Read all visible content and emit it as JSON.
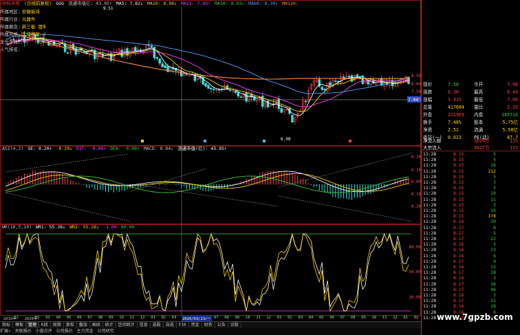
{
  "colors": {
    "up": "#ff4040",
    "down": "#40e0e0",
    "ma5": "#ffffff",
    "ma10": "#ffd400",
    "ma20": "#ff40ff",
    "ma60": "#30d040",
    "ma120": "#5aa0ff",
    "ma250": "#ff9040",
    "bg": "#000000"
  },
  "main_header": [
    "中科天塔",
    "(日线前复权)",
    "GGG",
    "流通市值亿: 43.95↑",
    "MA5: 7.82↓",
    "MA10: 8.08↓",
    "MA21: 7.95↑",
    "MA30: 8.03↓",
    "MA60: 8.30↓",
    "MA120: 8.88↓",
    "MA144: 9.14↓",
    "MA250: 8.82↑",
    "市场牛熊: 6.3"
  ],
  "sidebar": [
    {
      "k": "所属地区:",
      "v": "安徽板块"
    },
    {
      "k": "所属行业:",
      "v": "元器件"
    },
    {
      "k": "所属概念:",
      "v": "新三板 锂电池 燃料电池 新能源车 充电桩"
    },
    {
      "k": "所属风格:",
      "v": "定增预案 小盘"
    },
    {
      "k": "龙头个股:",
      "v": ""
    },
    {
      "k": "人气排名:",
      "v": ""
    }
  ],
  "main_ylabels": [
    "8.50",
    "8.00",
    "7.50",
    "7.00"
  ],
  "price_tag": "7.50",
  "price_level_tag": "7.06",
  "low_label": "6.98",
  "high_label": "9.51",
  "macd_header": [
    "ASI(4,2)",
    "SE: 0.20↑",
    "-0.20↓",
    "DIF: -0.06↑",
    "DEA: -0.08↑",
    "MACD: 0.04↓",
    "流通市值(亿): 43.95↑"
  ],
  "macd_ylabels": [
    "0.20",
    "0.10",
    "0.00",
    "-0.10",
    "-0.20"
  ],
  "wr_header": [
    "WR(10,5,10)",
    "WR1: 55.26↓",
    "WR2: 55.26↓",
    "-1.00",
    "80.00"
  ],
  "wr_ylabels": [
    "80.00",
    "50.00",
    "20.00"
  ],
  "x_labels": [
    "2019年",
    "12",
    "2020年",
    "02",
    "03",
    "04",
    "05",
    "06",
    "07",
    "08",
    "09",
    "10",
    "11",
    "12",
    "01",
    "02",
    "03",
    "04",
    "05",
    "06",
    "07",
    "08",
    "09",
    "10",
    "11",
    "12",
    "01",
    "02",
    "03",
    "04",
    "05",
    "06",
    "07",
    "08",
    "09",
    "10",
    "11",
    "12",
    "01",
    "02"
  ],
  "cursor_date": "2020/03/23/一",
  "tabs": [
    "指标",
    "模板",
    "管理",
    "K线",
    "周期",
    "复权",
    "叠加",
    "画线",
    "统计",
    "区间统计",
    "信息",
    "选股",
    "自选",
    "F10",
    "资金",
    "财务",
    "公告",
    "诊股"
  ],
  "status": [
    "扩展↑",
    "关联报价",
    "小窗点评",
    "公司报价",
    "主力资金",
    "公司研究"
  ],
  "quote": {
    "rows": [
      {
        "k1": "现价",
        "v1": "7.50",
        "c1": "green",
        "k2": "今开",
        "v2": "7.96",
        "c2": "red"
      },
      {
        "k1": "涨跌",
        "v1": "0.30",
        "c1": "red",
        "k2": "最高",
        "v2": "8.49",
        "c2": "red"
      },
      {
        "k1": "涨幅",
        "v1": "3.91%",
        "c1": "red",
        "k2": "最低",
        "v2": "7.66",
        "c2": "red"
      },
      {
        "k1": "总量",
        "v1": "417684",
        "c1": "yel",
        "k2": "量比",
        "v2": "2.31",
        "c2": "red"
      },
      {
        "k1": "外盘",
        "v1": "231969",
        "c1": "red",
        "k2": "内盘",
        "v2": "185716",
        "c2": "green"
      },
      {
        "k1": "换手",
        "v1": "7.48%",
        "c1": "yel",
        "k2": "股本",
        "v2": "5.75亿",
        "c2": "yel"
      },
      {
        "k1": "净资",
        "v1": "2.51",
        "c1": "yel",
        "k2": "流通",
        "v2": "5.58亿",
        "c2": "yel"
      },
      {
        "k1": "收益(一)",
        "v1": "0.023",
        "c1": "yel",
        "k2": "PE(动)",
        "v2": "87.7",
        "c2": "yel"
      }
    ],
    "flow": [
      {
        "k": "净流入额",
        "v": "3829万",
        "p": "11%"
      },
      {
        "k": "大宗流入",
        "v": "3827万",
        "p": "11%"
      }
    ]
  },
  "ticks": [
    {
      "t": "11:28",
      "p": "8.15",
      "v": "5"
    },
    {
      "t": "11:28",
      "p": "8.15",
      "v": "5"
    },
    {
      "t": "11:28",
      "p": "8.15",
      "v": "16"
    },
    {
      "t": "11:28",
      "p": "8.15",
      "v": "212"
    },
    {
      "t": "11:28",
      "p": "8.15",
      "v": "5"
    },
    {
      "t": "11:28",
      "p": "8.15",
      "v": "3"
    },
    {
      "t": "11:28",
      "p": "8.15",
      "v": "5"
    },
    {
      "t": "11:28",
      "p": "8.15",
      "v": "20"
    },
    {
      "t": "11:28",
      "p": "8.15",
      "v": "11"
    },
    {
      "t": "11:28",
      "p": "8.15",
      "v": "3"
    },
    {
      "t": "11:28",
      "p": "8.15",
      "v": "16"
    },
    {
      "t": "11:28",
      "p": "8.15",
      "v": "178"
    },
    {
      "t": "11:28",
      "p": "8.16",
      "v": "20"
    },
    {
      "t": "11:28",
      "p": "8.17",
      "v": "8"
    },
    {
      "t": "11:28",
      "p": "8.17",
      "v": "5"
    },
    {
      "t": "11:28",
      "p": "8.17",
      "v": "22"
    },
    {
      "t": "11:28",
      "p": "8.16",
      "v": "5"
    },
    {
      "t": "11:28",
      "p": "8.16",
      "v": "23"
    },
    {
      "t": "11:28",
      "p": "8.16",
      "v": "6"
    },
    {
      "t": "11:28",
      "p": "8.17",
      "v": "9"
    },
    {
      "t": "11:28",
      "p": "8.16",
      "v": "11"
    },
    {
      "t": "11:28",
      "p": "8.17",
      "v": "18"
    },
    {
      "t": "11:28",
      "p": "8.16",
      "v": "3"
    },
    {
      "t": "11:28",
      "p": "8.17",
      "v": "16"
    },
    {
      "t": "11:28",
      "p": "8.17",
      "v": "46"
    },
    {
      "t": "11:28",
      "p": "8.16",
      "v": "2"
    },
    {
      "t": "11:28",
      "p": "8.17",
      "v": "11"
    },
    {
      "t": "11:28",
      "p": "8.16",
      "v": "28"
    },
    {
      "t": "11:28",
      "p": "8.16",
      "v": "8"
    },
    {
      "t": "11:28",
      "p": "8.17",
      "v": "15"
    }
  ],
  "watermark": "www.7gpzb.com"
}
